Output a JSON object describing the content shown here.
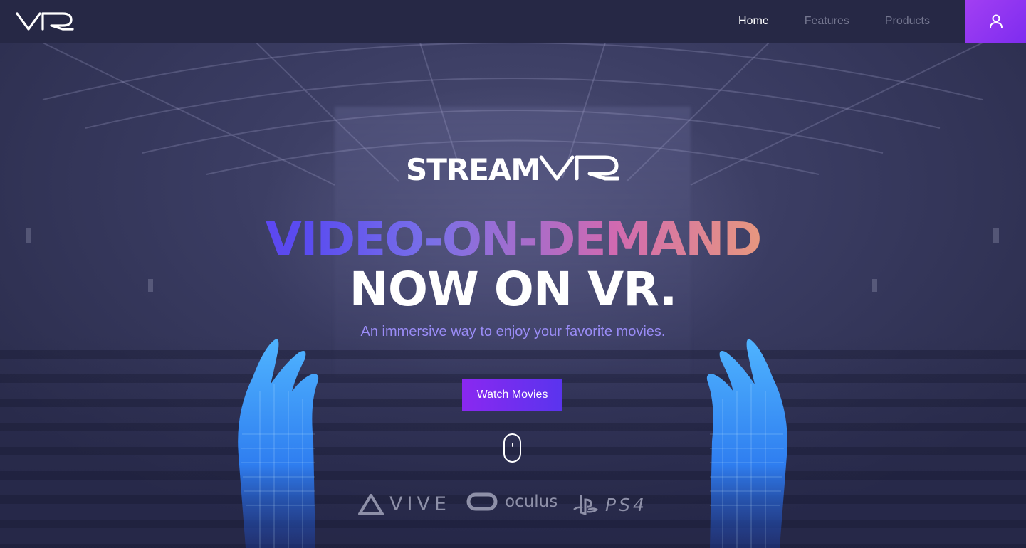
{
  "nav": {
    "logo_text": "VR",
    "links": [
      {
        "label": "Home",
        "active": true
      },
      {
        "label": "Features",
        "active": false
      },
      {
        "label": "Products",
        "active": false
      }
    ],
    "user_icon": "user-icon"
  },
  "hero": {
    "brand_logo": "STREAMVR",
    "headline_1": "VIDEO-ON-DEMAND",
    "headline_2": "NOW ON VR.",
    "subtitle": "An immersive way to enjoy your favorite movies.",
    "cta_label": "Watch Movies",
    "scroll_icon": "mouse-scroll-icon"
  },
  "platforms": {
    "vive": "VIVE",
    "oculus": "oculus",
    "ps4": "PS4"
  },
  "colors": {
    "navbar_bg": "#262845",
    "accent_purple": "#8a28f0",
    "subtitle": "#9a8cf6",
    "nav_inactive": "#74768f"
  }
}
